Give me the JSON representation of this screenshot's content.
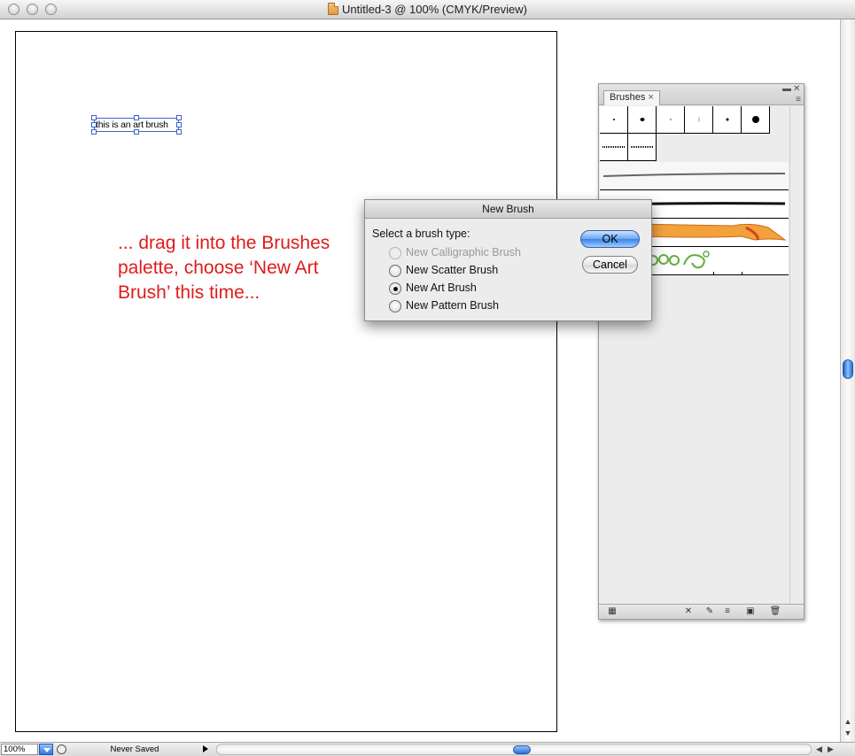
{
  "window": {
    "title": "Untitled-3 @ 100% (CMYK/Preview)"
  },
  "canvas": {
    "selected_text": "this is an art brush",
    "instruction": "... drag it into the Brushes palette, choose ‘New Art Brush’ this time..."
  },
  "brushes_palette": {
    "tab_label": "Brushes",
    "tab_close": "×",
    "minimize": "▬",
    "close": "✕",
    "menu": "≡"
  },
  "dialog": {
    "title": "New Brush",
    "prompt": "Select a brush type:",
    "options": [
      {
        "label": "New Calligraphic Brush",
        "selected": false,
        "disabled": true
      },
      {
        "label": "New Scatter Brush",
        "selected": false,
        "disabled": false
      },
      {
        "label": "New Art Brush",
        "selected": true,
        "disabled": false
      },
      {
        "label": "New Pattern Brush",
        "selected": false,
        "disabled": false
      }
    ],
    "ok_label": "OK",
    "cancel_label": "Cancel"
  },
  "statusbar": {
    "zoom": "100%",
    "status": "Never Saved"
  },
  "colors": {
    "instruction_text": "#e01b1b",
    "selection": "#3b64c9",
    "ok_button": "#3c82e6"
  }
}
